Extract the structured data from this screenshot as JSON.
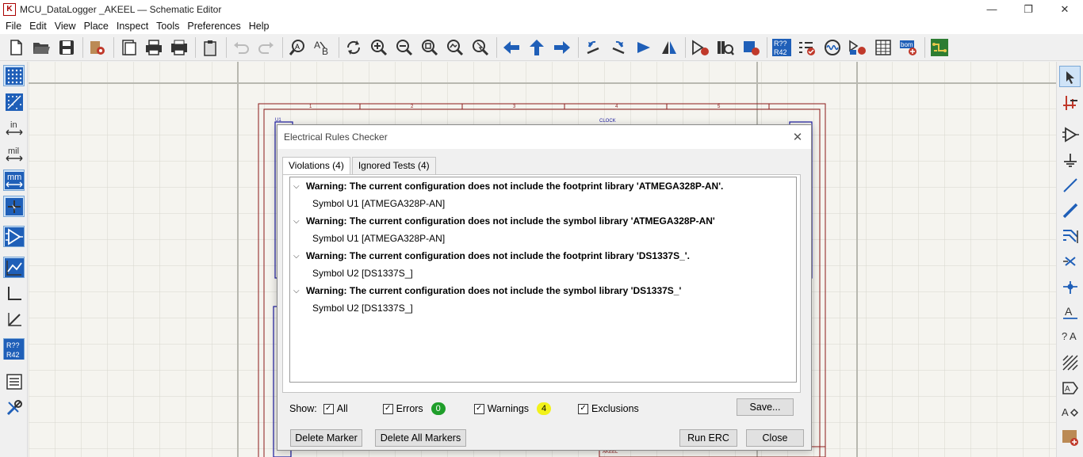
{
  "window": {
    "title": "MCU_DataLogger _AKEEL — Schematic Editor",
    "minimize": "—",
    "restore": "❐",
    "close": "✕"
  },
  "menu": [
    "File",
    "Edit",
    "View",
    "Place",
    "Inspect",
    "Tools",
    "Preferences",
    "Help"
  ],
  "left_toolbar": {
    "in_label": "in",
    "mil_label": "mil",
    "mm_label": "mm",
    "annotate_top": "R??",
    "annotate_bottom": "R42"
  },
  "toolbar": {
    "annotate_top": "R??",
    "annotate_bottom": "R42",
    "bom_label": "bom"
  },
  "canvas": {
    "frame_cols": [
      "1",
      "2",
      "3",
      "4",
      "5"
    ],
    "label_left": "U1",
    "label_right": "CLOCK",
    "title_block_text": "AKEEL"
  },
  "dialog": {
    "title": "Electrical Rules Checker",
    "close": "✕",
    "tabs": [
      {
        "label": "Violations (4)",
        "active": true
      },
      {
        "label": "Ignored Tests (4)",
        "active": false
      }
    ],
    "violations": [
      {
        "message": "Warning: The current configuration does not include the footprint library 'ATMEGA328P-AN'.",
        "item": "Symbol U1 [ATMEGA328P-AN]"
      },
      {
        "message": "Warning: The current configuration does not include the symbol library 'ATMEGA328P-AN'",
        "item": "Symbol U1 [ATMEGA328P-AN]"
      },
      {
        "message": "Warning: The current configuration does not include the footprint library 'DS1337S_'.",
        "item": "Symbol U2 [DS1337S_]"
      },
      {
        "message": "Warning: The current configuration does not include the symbol library 'DS1337S_'",
        "item": "Symbol U2 [DS1337S_]"
      }
    ],
    "show": {
      "label": "Show:",
      "all": "All",
      "errors": "Errors",
      "errors_count": "0",
      "warnings": "Warnings",
      "warnings_count": "4",
      "exclusions": "Exclusions",
      "check_mark": "✓"
    },
    "buttons": {
      "save": "Save...",
      "delete_marker": "Delete Marker",
      "delete_all_markers": "Delete All Markers",
      "run_erc": "Run ERC",
      "close": "Close"
    }
  },
  "colors": {
    "canvas_bg": "#f5f4ef",
    "grid": "#d8d8d0",
    "frame": "#8b1a1a",
    "symbol": "#1a1aa0",
    "errors_badge": "#1f9e2a",
    "warnings_badge": "#f2f21a",
    "toolbar_icon_blue": "#1f5fb8"
  }
}
